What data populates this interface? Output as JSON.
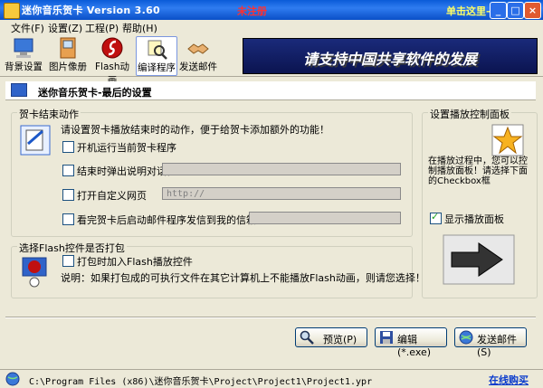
{
  "window": {
    "title": "迷你音乐贺卡 Version 3.60",
    "unregistered": "未注册",
    "click_here": "单击这里—>>"
  },
  "menu": [
    "文件(F)",
    "设置(Z)",
    "工程(P)",
    "帮助(H)"
  ],
  "toolbar": {
    "buttons": [
      "背景设置",
      "图片像册",
      "Flash动画",
      "编译程序",
      "发送邮件"
    ],
    "active": "编译程序"
  },
  "banner": "请支持中国共享软件的发展",
  "section_title": "迷你音乐贺卡-最后的设置",
  "end_action_group": {
    "legend": "贺卡结束动作",
    "description": "请设置贺卡播放结束时的动作，便于给贺卡添加额外的功能！",
    "options": [
      {
        "label": "开机运行当前贺卡程序",
        "checked": false
      },
      {
        "label": "结束时弹出说明对话框",
        "checked": false
      },
      {
        "label": "打开自定义网页",
        "checked": false,
        "value": "http://"
      },
      {
        "label": "看完贺卡后启动邮件程序发信到我的信箱:",
        "checked": false
      }
    ]
  },
  "flash_group": {
    "legend": "选择Flash控件是否打包",
    "option_label": "打包时加入Flash播放控件",
    "option_checked": false,
    "note": "说明：如果打包成的可执行文件在其它计算机上不能播放Flash动画，则请您选择！"
  },
  "control_panel_group": {
    "legend": "设置播放控制面板",
    "description": "在播放过程中，您可以控制播放面板！请选择下面的Checkbox框",
    "show_label": "显示播放面板",
    "show_checked": true
  },
  "actions": {
    "preview": "预览(P)",
    "edit": "编辑(*.exe)",
    "send": "发送邮件(S)"
  },
  "status": {
    "path": "C:\\Program Files (x86)\\迷你音乐贺卡\\Project\\Project1\\Project1.ypr",
    "buy": "在线购买"
  }
}
